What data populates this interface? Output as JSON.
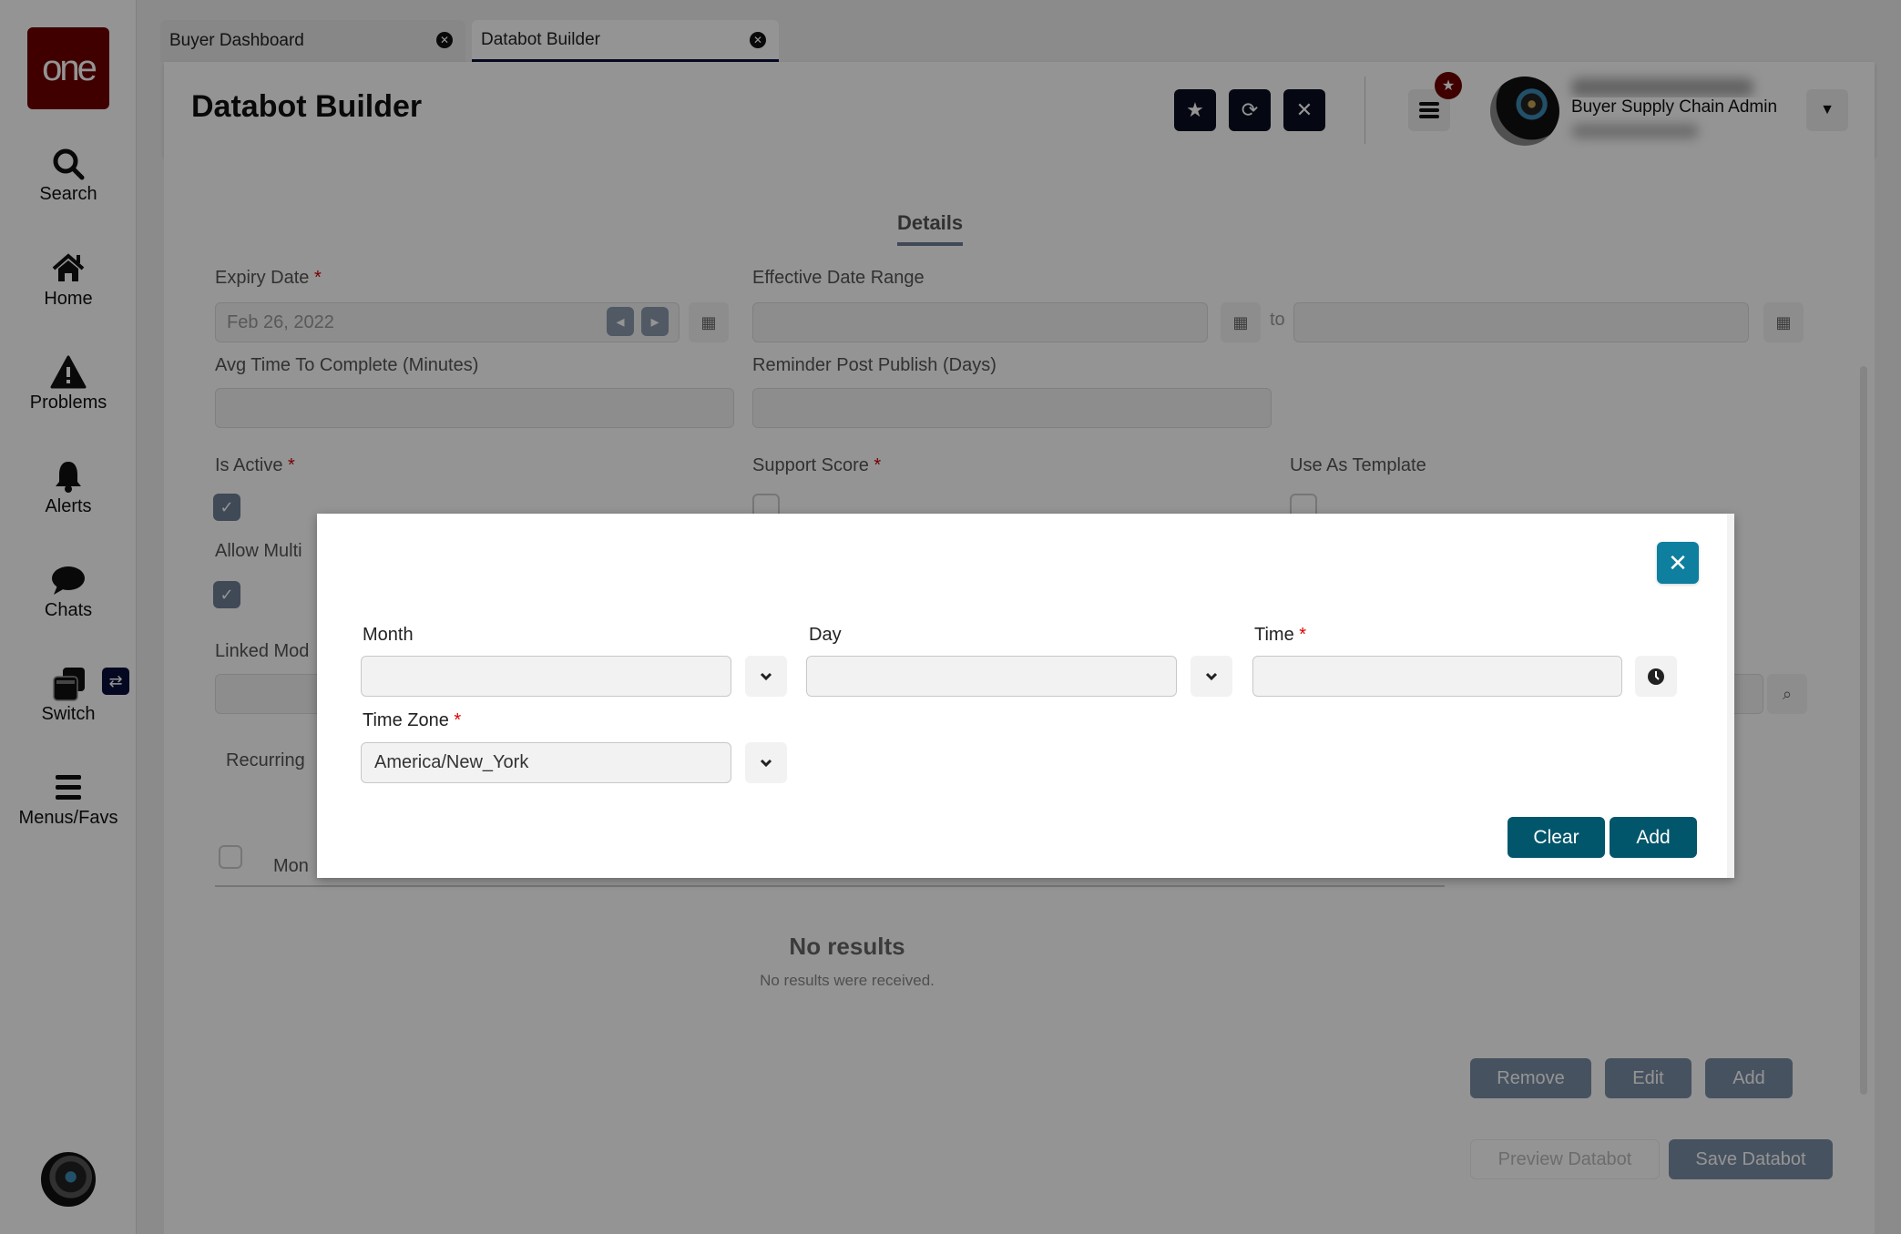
{
  "sidebar": {
    "logo_text": "one",
    "items": [
      {
        "label": "Search",
        "icon": "search-icon"
      },
      {
        "label": "Home",
        "icon": "home-icon"
      },
      {
        "label": "Problems",
        "icon": "warning-icon"
      },
      {
        "label": "Alerts",
        "icon": "bell-icon"
      },
      {
        "label": "Chats",
        "icon": "chat-bubble-icon"
      },
      {
        "label": "Switch",
        "icon": "windows-icon"
      },
      {
        "label": "Menus/Favs",
        "icon": "hamburger-icon"
      }
    ],
    "switch_badge_icon": "⇄"
  },
  "tabs": [
    {
      "label": "Buyer Dashboard",
      "active": false
    },
    {
      "label": "Databot Builder",
      "active": true
    }
  ],
  "header": {
    "title": "Databot Builder",
    "buttons": {
      "favorite": "★",
      "refresh": "⟳",
      "close": "✕"
    },
    "menu_badge": "★",
    "user_role": "Buyer Supply Chain Admin",
    "user_dropdown": "⌄"
  },
  "form": {
    "section_tab": "Details",
    "expiry_date": {
      "label": "Expiry Date",
      "value": "Feb 26, 2022",
      "required": true
    },
    "effective_date_range": {
      "label": "Effective Date Range",
      "separator": "to"
    },
    "avg_time": {
      "label": "Avg Time To Complete (Minutes)"
    },
    "reminder": {
      "label": "Reminder Post Publish (Days)"
    },
    "is_active": {
      "label": "Is Active",
      "checked": true,
      "required": true
    },
    "support_score": {
      "label": "Support Score",
      "checked": false,
      "required": true
    },
    "use_as_template": {
      "label": "Use As Template",
      "checked": false
    },
    "allow_multiple": {
      "label": "Allow Multi",
      "checked": true
    },
    "linked_model": {
      "label": "Linked Mod"
    },
    "recurring_tab": "Recurring",
    "table_col": "Mon",
    "no_results_title": "No results",
    "no_results_text": "No results were received.",
    "table_buttons": {
      "remove": "Remove",
      "edit": "Edit",
      "add": "Add"
    },
    "footer_buttons": {
      "preview": "Preview Databot",
      "save": "Save Databot"
    }
  },
  "modal": {
    "close_icon": "✕",
    "month": {
      "label": "Month",
      "value": "",
      "required": false
    },
    "day": {
      "label": "Day",
      "value": "",
      "required": false
    },
    "time": {
      "label": "Time",
      "value": "",
      "required": true
    },
    "time_zone": {
      "label": "Time Zone",
      "value": "America/New_York",
      "required": true
    },
    "required_marker": "*",
    "chevron": "⌄",
    "clear_label": "Clear",
    "add_label": "Add"
  },
  "colors": {
    "brand": "#6e0000",
    "primary_button": "#02566b",
    "modal_close": "#0e7f9e",
    "required": "#d00000"
  }
}
